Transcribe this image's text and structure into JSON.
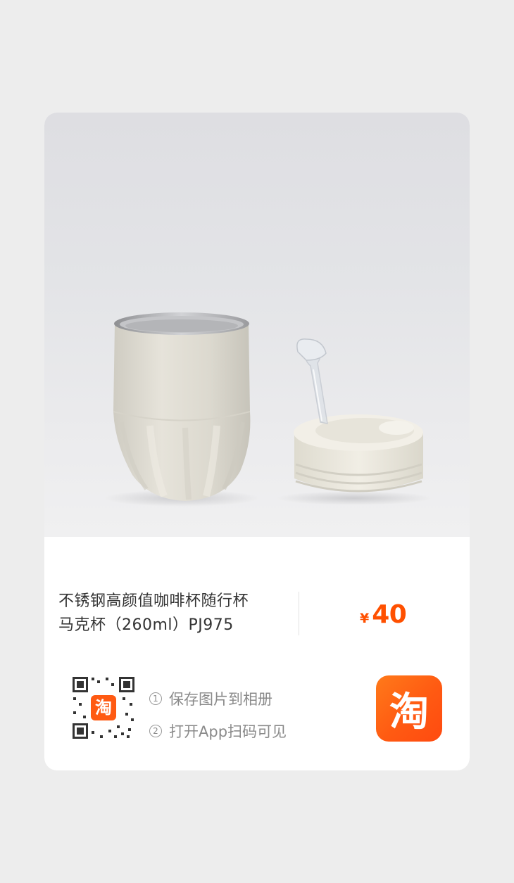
{
  "product": {
    "title_line1": "不锈钢高颜值咖啡杯随行杯",
    "title_line2": "马克杯（260ml）PJ975",
    "price_symbol": "¥",
    "price_value": "40"
  },
  "instructions": {
    "step1_number": "1",
    "step1_text": "保存图片到相册",
    "step2_number": "2",
    "step2_text": "打开App扫码可见"
  },
  "logo": {
    "char": "淘",
    "color": "#ff5000"
  },
  "qr": {
    "center_char": "淘"
  },
  "colors": {
    "accent": "#ff5000",
    "background": "#ededed",
    "card": "#ffffff"
  }
}
